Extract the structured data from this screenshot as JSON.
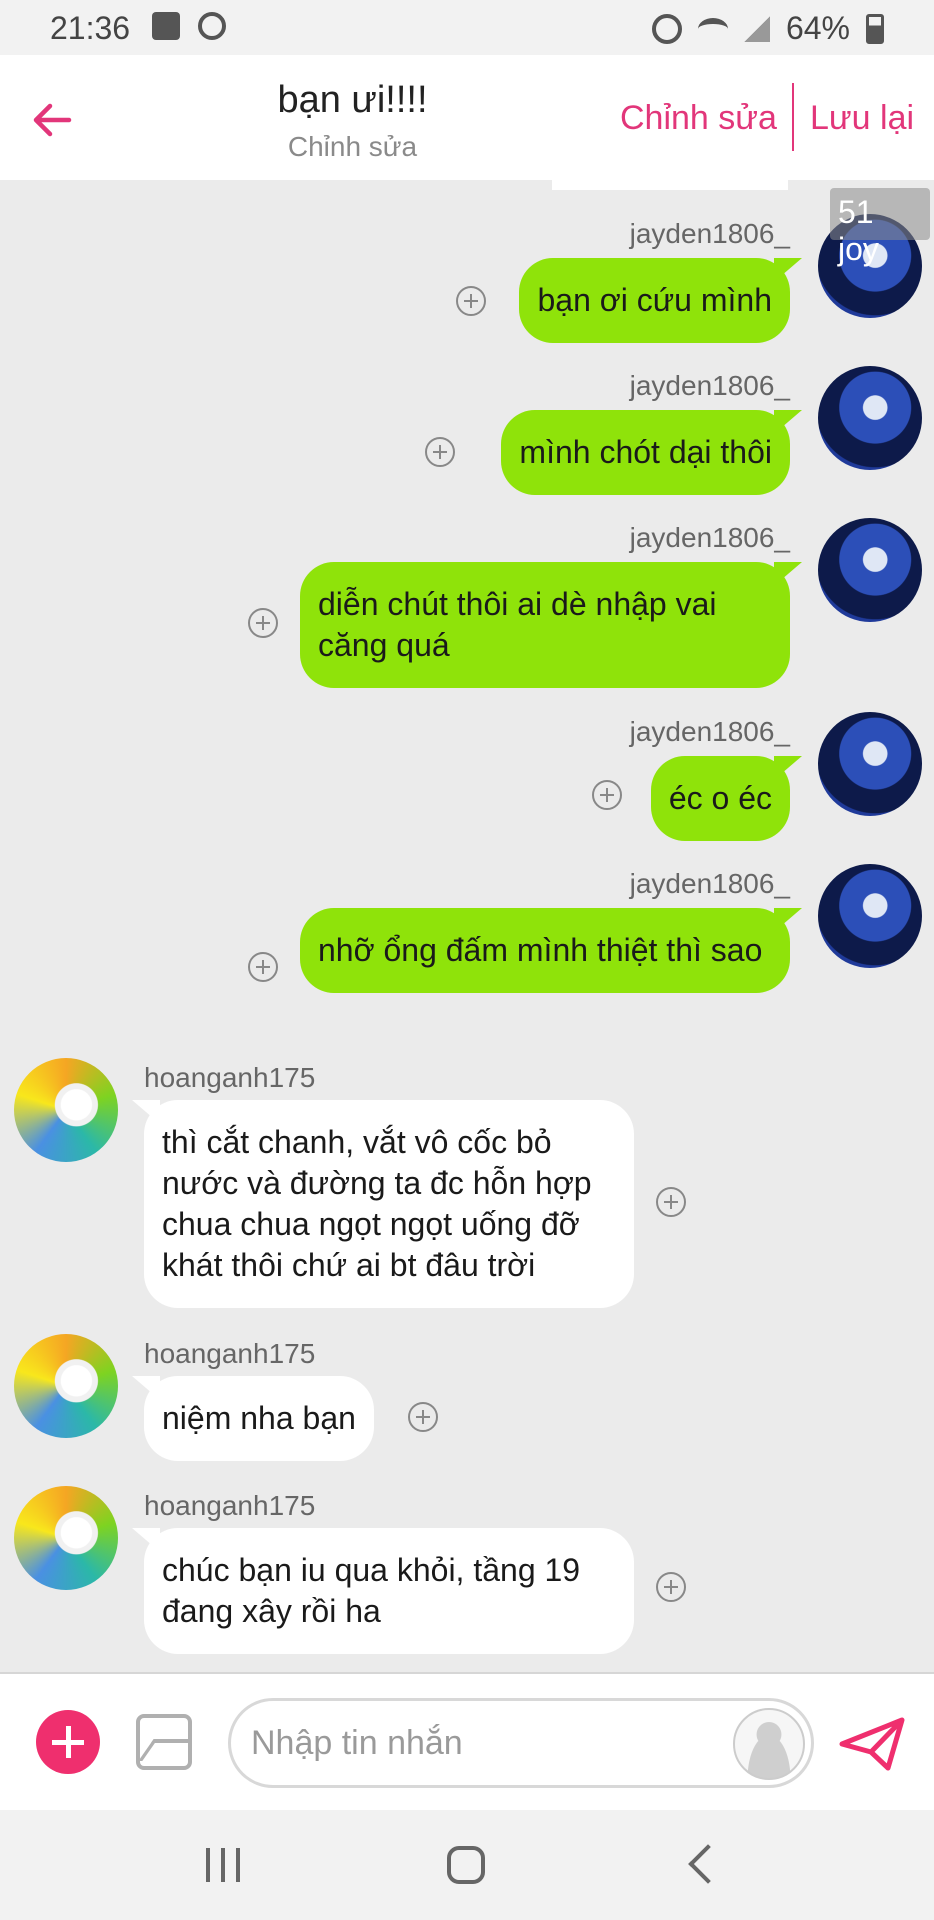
{
  "status_bar": {
    "time": "21:36",
    "battery_percent": "64%",
    "left_icons": [
      "image-icon",
      "headphones-icon"
    ],
    "right_icons": [
      "alarm-icon",
      "wifi-icon",
      "signal-icon",
      "battery-icon"
    ]
  },
  "header": {
    "title": "bạn ưi!!!!",
    "subtitle": "Chỉnh sửa",
    "edit_label": "Chỉnh sửa",
    "save_label": "Lưu lại",
    "accent_color": "#e2367a"
  },
  "watermark": "51 joy",
  "messages": [
    {
      "sender": "jayden1806_",
      "text": "bạn ơi cứu mình",
      "direction": "outgoing"
    },
    {
      "sender": "jayden1806_",
      "text": "mình chót dại thôi",
      "direction": "outgoing"
    },
    {
      "sender": "jayden1806_",
      "text": "diễn chút thôi ai dè nhập vai căng quá",
      "direction": "outgoing"
    },
    {
      "sender": "jayden1806_",
      "text": "éc o éc",
      "direction": "outgoing"
    },
    {
      "sender": "jayden1806_",
      "text": "nhỡ ổng đấm mình thiệt thì sao",
      "direction": "outgoing"
    },
    {
      "sender": "hoanganh175",
      "text": "thì cắt chanh, vắt vô cốc bỏ nước và đường ta đc hỗn hợp chua chua ngọt ngọt uống đỡ khát thôi chứ ai bt đâu trời",
      "direction": "incoming"
    },
    {
      "sender": "hoanganh175",
      "text": "niệm nha bạn",
      "direction": "incoming"
    },
    {
      "sender": "hoanganh175",
      "text": "chúc bạn iu qua khỏi, tầng 19 đang xây rồi ha",
      "direction": "incoming"
    }
  ],
  "colors": {
    "outgoing_bubble": "#8fe30a",
    "incoming_bubble": "#ffffff",
    "chat_background": "#ebebeb",
    "send_accent": "#ef2f6e"
  },
  "input": {
    "placeholder": "Nhập tin nhắn",
    "value": ""
  }
}
